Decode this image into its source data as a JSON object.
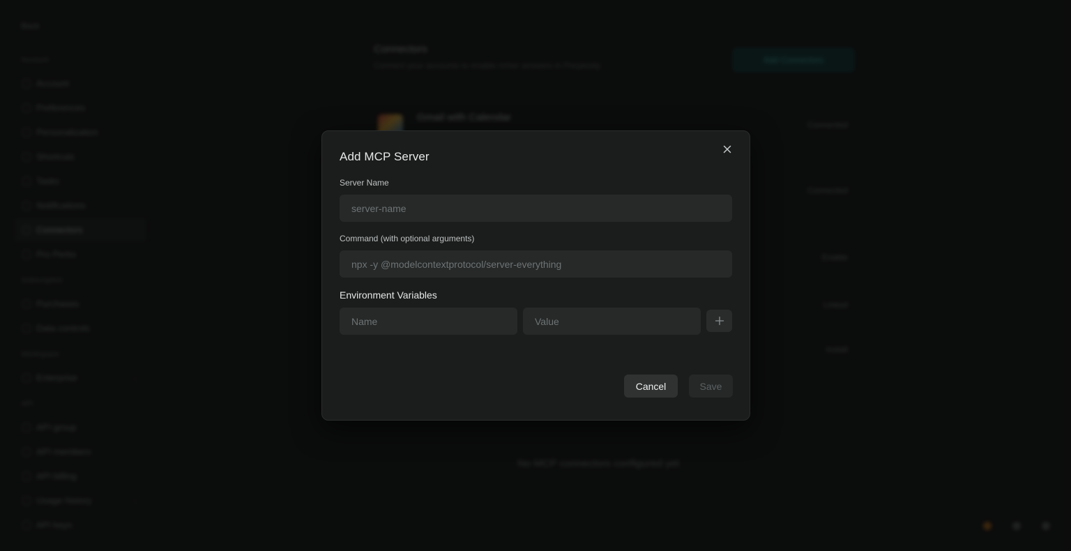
{
  "background": {
    "sidebar": {
      "back_label": "Back",
      "sections": [
        {
          "label": "Account",
          "items": [
            {
              "label": "Account",
              "active": false,
              "chevron": false
            },
            {
              "label": "Preferences",
              "active": false,
              "chevron": false
            },
            {
              "label": "Personalization",
              "active": false,
              "chevron": false
            },
            {
              "label": "Shortcuts",
              "active": false,
              "chevron": false
            },
            {
              "label": "Tasks",
              "active": false,
              "chevron": false
            },
            {
              "label": "Notifications",
              "active": false,
              "chevron": false
            },
            {
              "label": "Connectors",
              "active": true,
              "chevron": false
            },
            {
              "label": "Pro Perks",
              "active": false,
              "chevron": false
            }
          ]
        },
        {
          "label": "Subscription",
          "items": [
            {
              "label": "Purchases",
              "active": false,
              "chevron": false
            },
            {
              "label": "Data controls",
              "active": false,
              "chevron": false
            }
          ]
        },
        {
          "label": "Workspace",
          "items": [
            {
              "label": "Enterprise",
              "active": false,
              "chevron": true
            }
          ]
        },
        {
          "label": "API",
          "items": [
            {
              "label": "API group",
              "active": false,
              "chevron": false
            },
            {
              "label": "API members",
              "active": false,
              "chevron": false
            },
            {
              "label": "API billing",
              "active": false,
              "chevron": false
            },
            {
              "label": "Usage history",
              "active": false,
              "chevron": true
            },
            {
              "label": "API keys",
              "active": false,
              "chevron": false
            }
          ]
        }
      ]
    },
    "main": {
      "title": "Connectors",
      "subtitle": "Connect your accounts to enable richer answers in Perplexity",
      "add_button": "Add Connectors",
      "connectors": [
        {
          "name": "Gmail with Calendar",
          "state": "Connected"
        },
        {
          "name": "",
          "state": "Connected"
        },
        {
          "name": "",
          "state": "Enable"
        },
        {
          "name": "",
          "state": "Linked"
        },
        {
          "name": "",
          "state": "Install"
        }
      ],
      "empty_message": "No MCP connectors configured yet"
    }
  },
  "modal": {
    "title": "Add MCP Server",
    "close_icon": "close-icon",
    "server_name": {
      "label": "Server Name",
      "value": "",
      "placeholder": "server-name"
    },
    "command": {
      "label": "Command (with optional arguments)",
      "value": "",
      "placeholder": "npx -y @modelcontextprotocol/server-everything"
    },
    "env": {
      "label": "Environment Variables",
      "name_placeholder": "Name",
      "value_placeholder": "Value",
      "add_icon": "plus-icon"
    },
    "cancel_label": "Cancel",
    "save_label": "Save"
  },
  "colors": {
    "modal_bg": "#1b1c1c",
    "input_bg": "#272929",
    "accent": "#47c7c2"
  }
}
